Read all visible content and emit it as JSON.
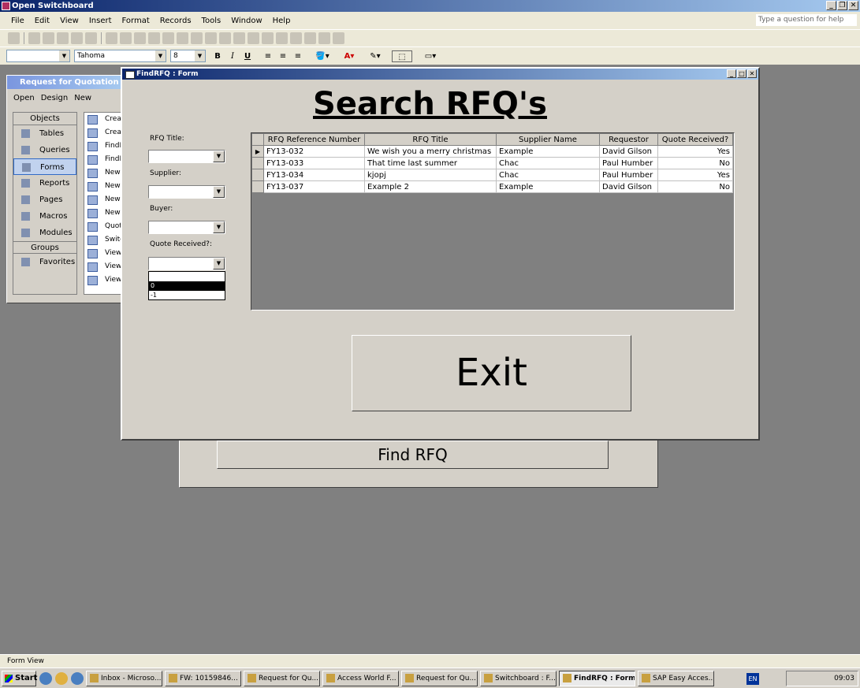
{
  "app": {
    "title": "Open Switchboard",
    "help_placeholder": "Type a question for help"
  },
  "menu": [
    "File",
    "Edit",
    "View",
    "Insert",
    "Format",
    "Records",
    "Tools",
    "Window",
    "Help"
  ],
  "format_bar": {
    "font": "Tahoma",
    "size": "8",
    "bold": "B",
    "italic": "I",
    "underline": "U"
  },
  "db_window": {
    "title": "Request for Quotation : Da",
    "toolbar": {
      "open": "Open",
      "design": "Design",
      "new": "New"
    },
    "objects_header": "Objects",
    "objects": [
      "Tables",
      "Queries",
      "Forms",
      "Reports",
      "Pages",
      "Macros",
      "Modules"
    ],
    "groups_header": "Groups",
    "groups": [
      "Favorites"
    ],
    "items": [
      "Crea",
      "Crea",
      "FindF",
      "FindF",
      "NewF",
      "NewF",
      "NewF",
      "NewS",
      "Quot",
      "Switc",
      "ViewI",
      "ViewI",
      "ViewI"
    ]
  },
  "switchboard": {
    "find_rfq": "Find RFQ"
  },
  "form": {
    "title": "FindRFQ : Form",
    "heading": "Search RFQ's",
    "labels": {
      "rfq_title": "RFQ Title:",
      "supplier": "Supplier:",
      "buyer": "Buyer:",
      "quote_received": "Quote Received?:"
    },
    "dropdown_options": [
      "",
      "0",
      "-1"
    ],
    "columns": [
      "RFQ Reference Number",
      "RFQ Title",
      "Supplier Name",
      "Requestor",
      "Quote Received?"
    ],
    "rows": [
      [
        "FY13-032",
        "We wish you a merry christmas",
        "Example",
        "David Gilson",
        "Yes"
      ],
      [
        "FY13-033",
        "That time last summer",
        "Chac",
        "Paul Humber",
        "No"
      ],
      [
        "FY13-034",
        "kjopj",
        "Chac",
        "Paul Humber",
        "Yes"
      ],
      [
        "FY13-037",
        "Example 2",
        "Example",
        "David Gilson",
        "No"
      ]
    ],
    "exit": "Exit"
  },
  "status": {
    "text": "Form View"
  },
  "taskbar": {
    "start": "Start",
    "tasks": [
      "Inbox - Microso...",
      "FW: 10159846...",
      "Request for Qu...",
      "Access World F...",
      "Request for Qu...",
      "Switchboard : F...",
      "FindRFQ : Form",
      "SAP Easy Acces..."
    ],
    "lang": "EN",
    "clock": "09:03"
  }
}
